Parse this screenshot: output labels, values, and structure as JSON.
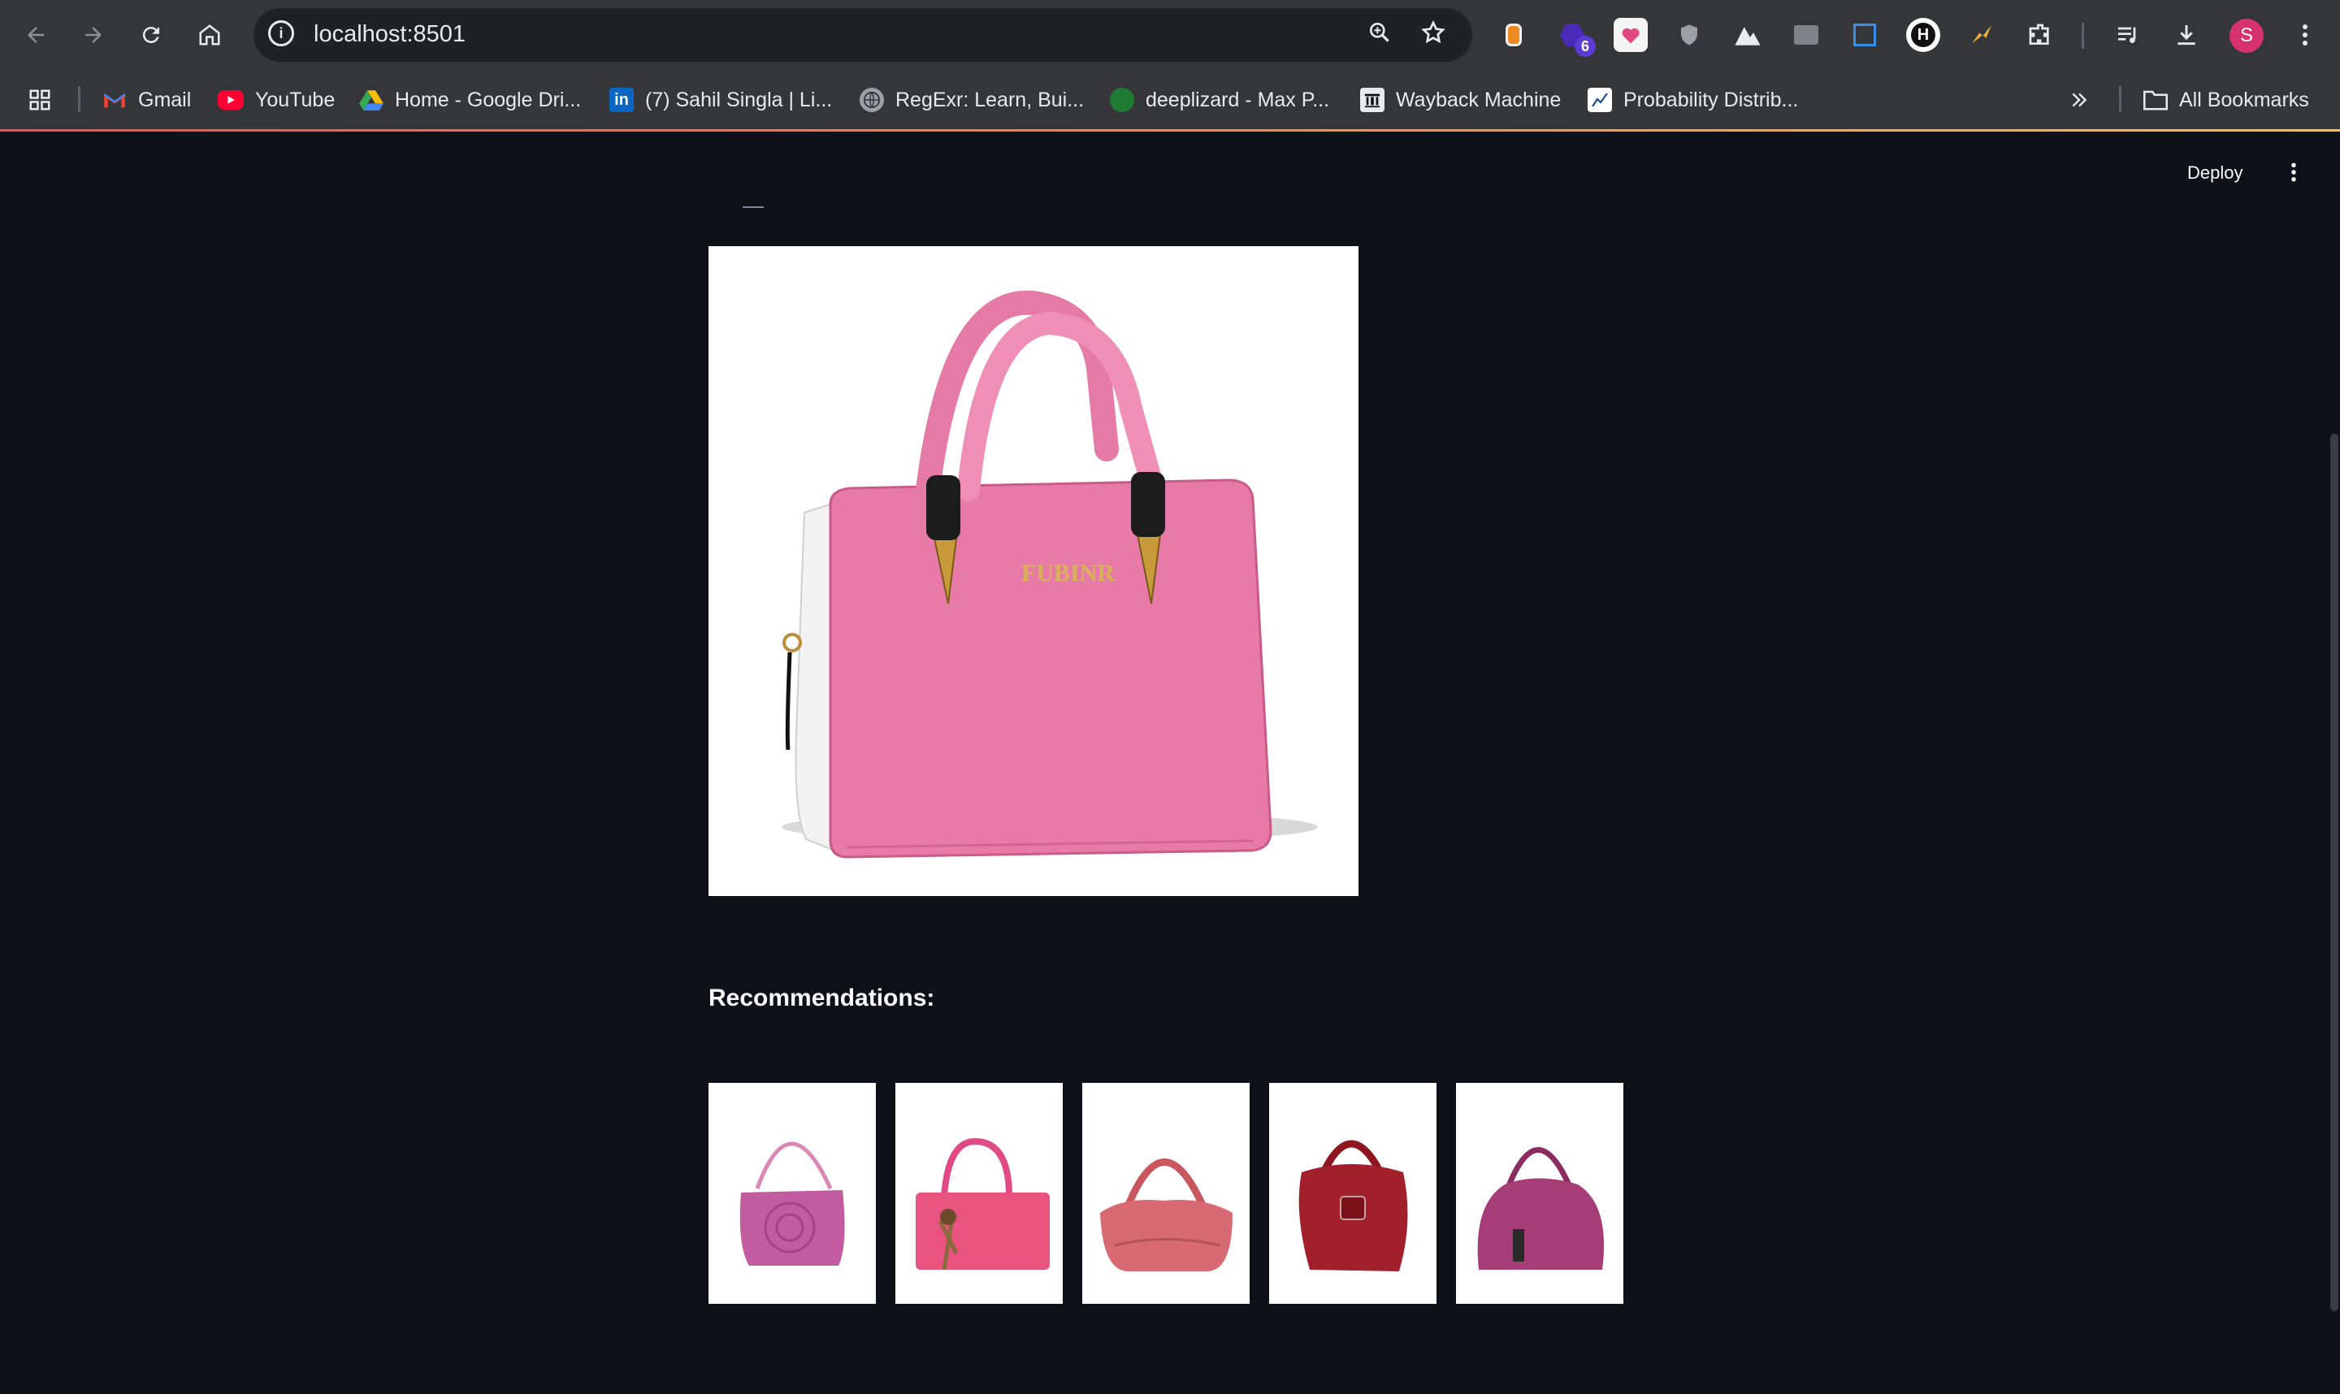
{
  "browser": {
    "url": "localhost:8501",
    "extension_badge": "6",
    "profile_initial": "S",
    "icons": [
      "back-icon",
      "forward-icon",
      "reload-icon",
      "home-icon",
      "info-icon",
      "zoom-icon",
      "star-icon",
      "extensions-icon",
      "media-icon",
      "download-icon",
      "menu-icon"
    ]
  },
  "bookmarks": {
    "items": [
      {
        "label": "Gmail"
      },
      {
        "label": "YouTube"
      },
      {
        "label": "Home - Google Dri..."
      },
      {
        "label": "(7) Sahil Singla | Li..."
      },
      {
        "label": "RegExr: Learn, Bui..."
      },
      {
        "label": "deeplizard - Max P..."
      },
      {
        "label": "Wayback Machine"
      },
      {
        "label": "Probability Distrib..."
      }
    ],
    "all_bookmarks": "All Bookmarks"
  },
  "app": {
    "deploy_label": "Deploy",
    "main_image_logo": "FUBINR",
    "recommendations_heading": "Recommendations:",
    "recommendations": [
      {
        "name": "pink-shoulder-bag"
      },
      {
        "name": "pink-tote-bag"
      },
      {
        "name": "salmon-pink-hobo-bag"
      },
      {
        "name": "dark-red-hobo-bag"
      },
      {
        "name": "plum-dome-bag"
      }
    ]
  },
  "colors": {
    "background": "#0e1117",
    "chrome": "#35363a",
    "accent": "#ff4b4b"
  }
}
